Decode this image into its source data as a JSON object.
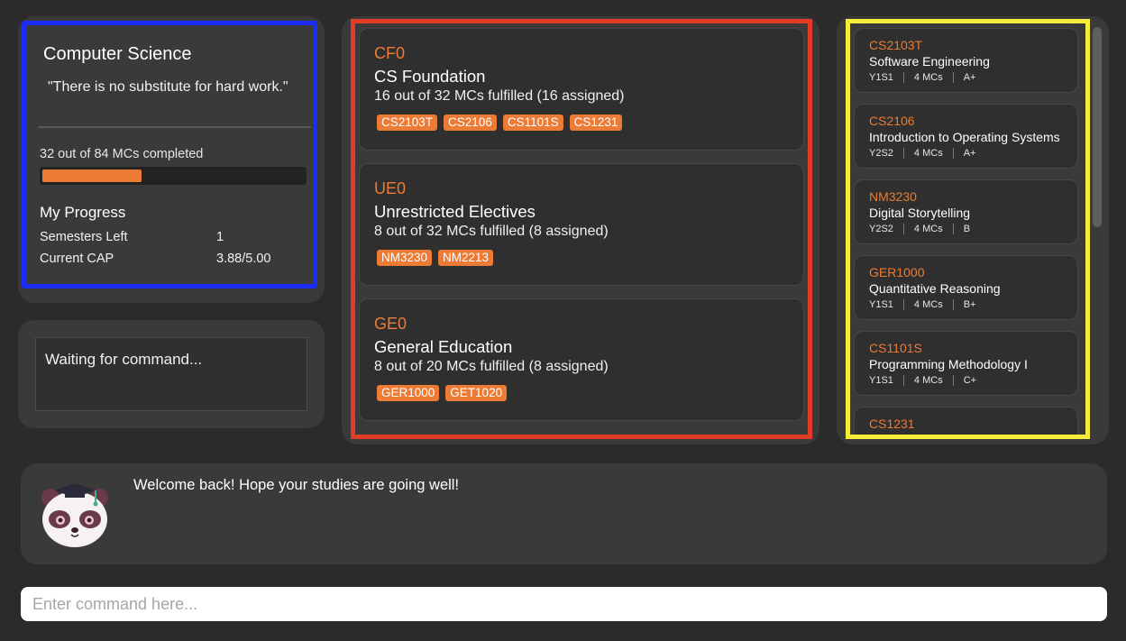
{
  "profile": {
    "course_name": "Computer Science",
    "motto": "\"There is no substitute for hard work.\"",
    "mc_completed_text": "32 out of 84 MCs completed",
    "mc_progress": 0.381,
    "progress_heading": "My Progress",
    "semesters_left_label": "Semesters Left",
    "semesters_left_value": "1",
    "cap_label": "Current CAP",
    "cap_value": "3.88/5.00"
  },
  "status": {
    "text": "Waiting for command..."
  },
  "requirements": [
    {
      "code": "CF0",
      "name": "CS Foundation",
      "progress": "16 out of 32 MCs fulfilled (16 assigned)",
      "tags": [
        "CS2103T",
        "CS2106",
        "CS1101S",
        "CS1231"
      ]
    },
    {
      "code": "UE0",
      "name": "Unrestricted Electives",
      "progress": "8 out of 32 MCs fulfilled (8 assigned)",
      "tags": [
        "NM3230",
        "NM2213"
      ]
    },
    {
      "code": "GE0",
      "name": "General Education",
      "progress": "8 out of 20 MCs fulfilled (8 assigned)",
      "tags": [
        "GER1000",
        "GET1020"
      ]
    }
  ],
  "modules": [
    {
      "code": "CS2103T",
      "title": "Software Engineering",
      "semester": "Y1S1",
      "mcs": "4 MCs",
      "grade": "A+"
    },
    {
      "code": "CS2106",
      "title": "Introduction to Operating Systems",
      "semester": "Y2S2",
      "mcs": "4 MCs",
      "grade": "A+"
    },
    {
      "code": "NM3230",
      "title": "Digital Storytelling",
      "semester": "Y2S2",
      "mcs": "4 MCs",
      "grade": "B"
    },
    {
      "code": "GER1000",
      "title": "Quantitative Reasoning",
      "semester": "Y1S1",
      "mcs": "4 MCs",
      "grade": "B+"
    },
    {
      "code": "CS1101S",
      "title": "Programming Methodology I",
      "semester": "Y1S1",
      "mcs": "4 MCs",
      "grade": "C+"
    },
    {
      "code": "CS1231",
      "title": "",
      "semester": "",
      "mcs": "",
      "grade": ""
    }
  ],
  "response": {
    "message": "Welcome back! Hope your studies are going well!",
    "mascot_icon": "panda-graduate-icon"
  },
  "command": {
    "placeholder": "Enter command here..."
  },
  "colors": {
    "accent": "#ec7b35",
    "profile_highlight": "#1a2cf5",
    "requirements_highlight": "#e23c28",
    "modules_highlight": "#f6ec3b"
  }
}
